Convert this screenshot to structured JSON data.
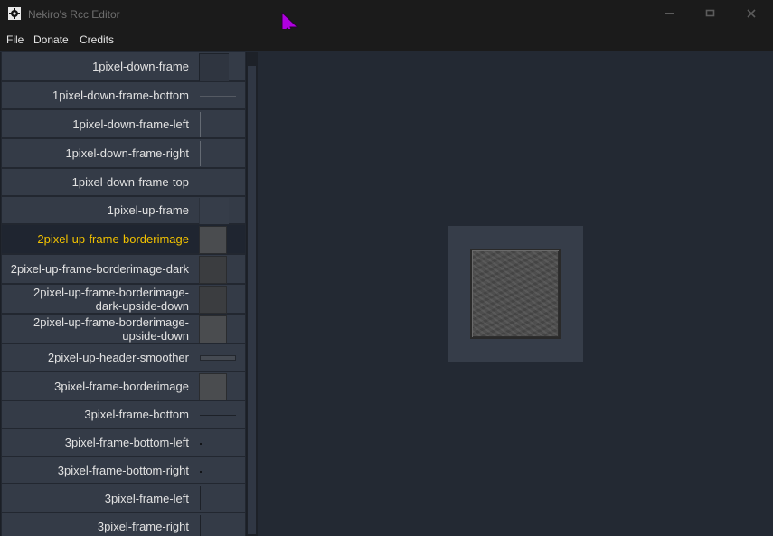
{
  "window": {
    "title": "Nekiro's Rcc Editor",
    "icon": "app-gear-icon"
  },
  "menu": [
    "File",
    "Donate",
    "Credits"
  ],
  "items": [
    {
      "label": "1pixel-down-frame",
      "preview": "frame-down"
    },
    {
      "label": "1pixel-down-frame-bottom",
      "preview": "hline"
    },
    {
      "label": "1pixel-down-frame-left",
      "preview": "vline-left"
    },
    {
      "label": "1pixel-down-frame-right",
      "preview": "vline-right"
    },
    {
      "label": "1pixel-down-frame-top",
      "preview": "hline-dark"
    },
    {
      "label": "1pixel-up-frame",
      "preview": "frame-up"
    },
    {
      "label": "2pixel-up-frame-borderimage",
      "preview": "texture",
      "selected": true
    },
    {
      "label": "2pixel-up-frame-borderimage-dark",
      "preview": "texture-dark"
    },
    {
      "label": "2pixel-up-frame-borderimage-\ndark-upside-down",
      "preview": "texture-dark"
    },
    {
      "label": "2pixel-up-frame-borderimage-\nupside-down",
      "preview": "texture"
    },
    {
      "label": "2pixel-up-header-smoother",
      "preview": "header"
    },
    {
      "label": "3pixel-frame-borderimage",
      "preview": "texture"
    },
    {
      "label": "3pixel-frame-bottom",
      "preview": "hline-dark"
    },
    {
      "label": "3pixel-frame-bottom-left",
      "preview": "dot"
    },
    {
      "label": "3pixel-frame-bottom-right",
      "preview": "dot"
    },
    {
      "label": "3pixel-frame-left",
      "preview": "vline-dark"
    },
    {
      "label": "3pixel-frame-right",
      "preview": "vline-dark"
    }
  ],
  "colors": {
    "selected_text": "#f2c200",
    "background": "#232933",
    "cursor": "#b000e0"
  }
}
